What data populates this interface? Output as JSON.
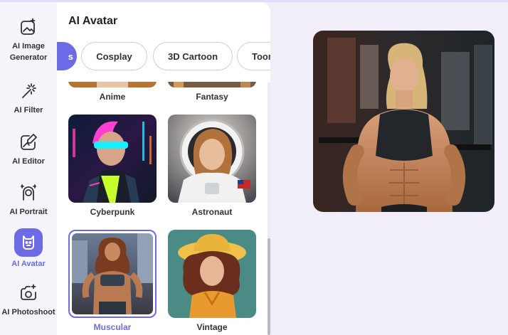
{
  "nav": {
    "items": [
      {
        "label": "AI Image Generator",
        "icon": "image-sparkle-icon"
      },
      {
        "label": "AI Filter",
        "icon": "magic-wand-icon"
      },
      {
        "label": "AI Editor",
        "icon": "image-edit-icon"
      },
      {
        "label": "AI Portrait",
        "icon": "portrait-icon"
      },
      {
        "label": "AI Avatar",
        "icon": "avatar-icon",
        "active": true
      },
      {
        "label": "AI Photoshoot",
        "icon": "camera-sparkle-icon"
      }
    ]
  },
  "panel": {
    "title": "AI Avatar",
    "tabs": [
      {
        "label": "s",
        "active": true
      },
      {
        "label": "Cosplay"
      },
      {
        "label": "3D Cartoon"
      },
      {
        "label": "Toon"
      }
    ],
    "styles": [
      {
        "label": "Anime"
      },
      {
        "label": "Fantasy"
      },
      {
        "label": "Cyberpunk"
      },
      {
        "label": "Astronaut"
      },
      {
        "label": "Muscular",
        "selected": true
      },
      {
        "label": "Vintage"
      }
    ]
  },
  "colors": {
    "accent": "#6d6ae6",
    "background": "#f1eef9"
  }
}
